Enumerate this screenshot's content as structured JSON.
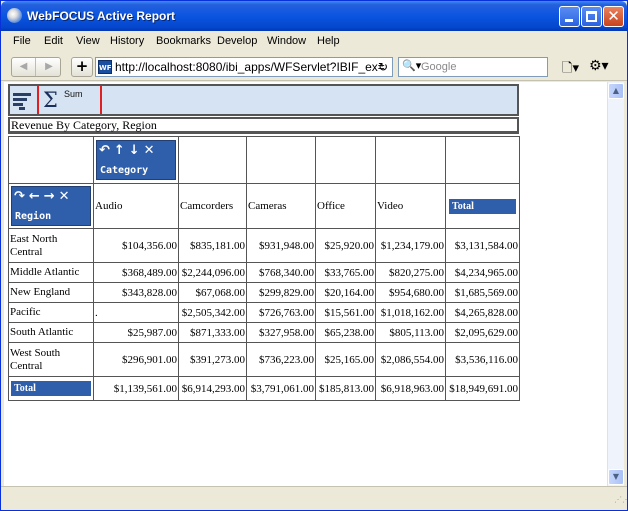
{
  "window": {
    "title": "WebFOCUS Active Report"
  },
  "menu": [
    "File",
    "Edit",
    "View",
    "History",
    "Bookmarks",
    "Develop",
    "Window",
    "Help"
  ],
  "nav": {
    "url": "http://localhost:8080/ibi_apps/WFServlet?IBIF_ex=",
    "search_placeholder": "Google",
    "url_icon": "WF"
  },
  "toolbar": {
    "sum_label": "Sum"
  },
  "report": {
    "title": "Revenue By Category, Region",
    "column_control_label": "Category",
    "row_control_label": "Region",
    "columns": [
      "Audio",
      "Camcorders",
      "Cameras",
      "Office",
      "Video",
      "Total"
    ],
    "rows": [
      {
        "region": "East North Central",
        "values": [
          "$104,356.00",
          "$835,181.00",
          "$931,948.00",
          "$25,920.00",
          "$1,234,179.00",
          "$3,131,584.00"
        ]
      },
      {
        "region": "Middle Atlantic",
        "values": [
          "$368,489.00",
          "$2,244,096.00",
          "$768,340.00",
          "$33,765.00",
          "$820,275.00",
          "$4,234,965.00"
        ]
      },
      {
        "region": "New England",
        "values": [
          "$343,828.00",
          "$67,068.00",
          "$299,829.00",
          "$20,164.00",
          "$954,680.00",
          "$1,685,569.00"
        ]
      },
      {
        "region": "Pacific",
        "values": [
          ".",
          "$2,505,342.00",
          "$726,763.00",
          "$15,561.00",
          "$1,018,162.00",
          "$4,265,828.00"
        ]
      },
      {
        "region": "South Atlantic",
        "values": [
          "$25,987.00",
          "$871,333.00",
          "$327,958.00",
          "$65,238.00",
          "$805,113.00",
          "$2,095,629.00"
        ]
      },
      {
        "region": "West South Central",
        "values": [
          "$296,901.00",
          "$391,273.00",
          "$736,223.00",
          "$25,165.00",
          "$2,086,554.00",
          "$3,536,116.00"
        ]
      }
    ],
    "total_row": {
      "label": "Total",
      "values": [
        "$1,139,561.00",
        "$6,914,293.00",
        "$3,791,061.00",
        "$185,813.00",
        "$6,918,963.00",
        "$18,949,691.00"
      ]
    }
  }
}
